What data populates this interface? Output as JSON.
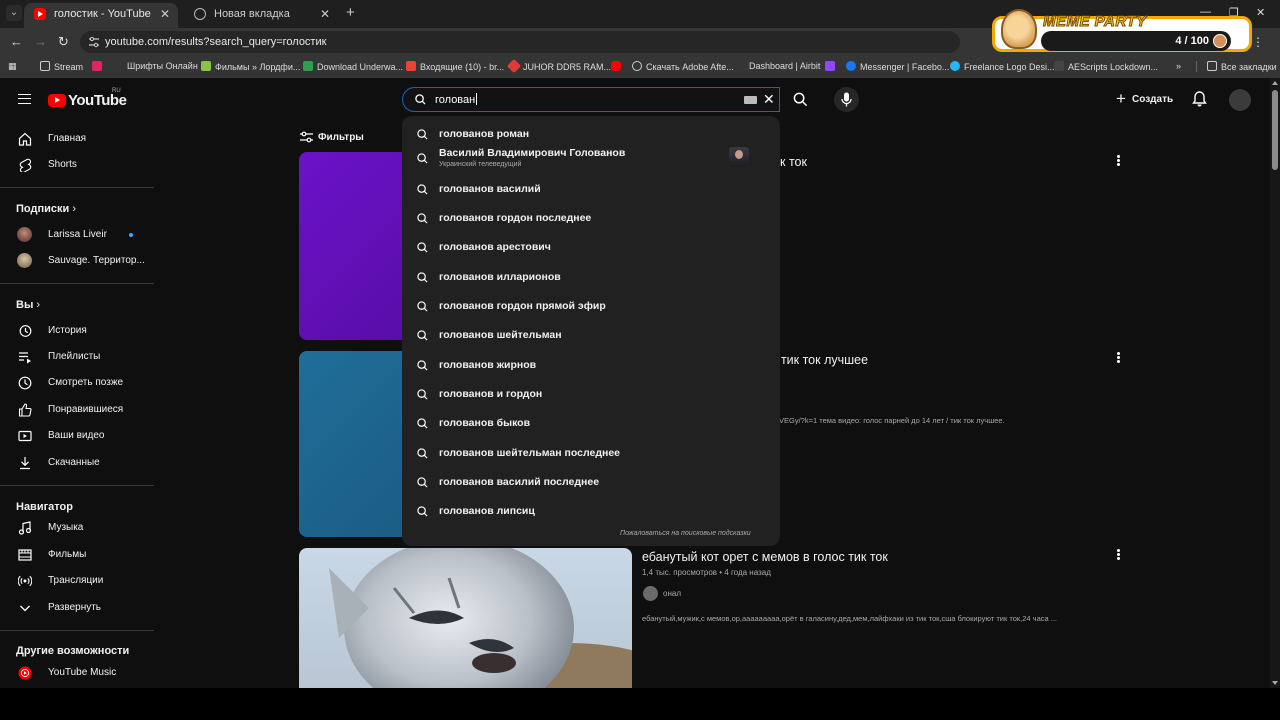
{
  "browser": {
    "tabs": [
      {
        "title": "голостик - YouTube",
        "active": true,
        "icon": "youtube-icon"
      },
      {
        "title": "Новая вкладка",
        "active": false,
        "icon": "globe-icon"
      }
    ],
    "url": "youtube.com/results?search_query=голостик",
    "bookmarks": [
      {
        "label": "Stream",
        "icon": "folder-icon"
      },
      {
        "label": "Шрифты Онлайн",
        "icon": "site-icon"
      },
      {
        "label": "Фильмы » Лордфи...",
        "icon": "site-icon"
      },
      {
        "label": "Download Underwa...",
        "icon": "site-icon"
      },
      {
        "label": "Входящие (10) - br...",
        "icon": "gmail-icon"
      },
      {
        "label": "JUHOR DDR5 RAM...",
        "icon": "site-icon"
      },
      {
        "label": "",
        "icon": "youtube-icon"
      },
      {
        "label": "Скачать Adobe Afte...",
        "icon": "globe-icon"
      },
      {
        "label": "Dashboard | Airbit",
        "icon": "site-icon"
      },
      {
        "label": "",
        "icon": "twitch-icon"
      },
      {
        "label": "Messenger | Facebo...",
        "icon": "facebook-icon"
      },
      {
        "label": "Freelance Logo Desi...",
        "icon": "site-icon"
      },
      {
        "label": "AEScripts Lockdown...",
        "icon": "site-icon"
      }
    ],
    "bookmarks_more": "»",
    "all_bookmarks": "Все закладки"
  },
  "overlay": {
    "brand": "MEME PARTY",
    "score": "4 / 100"
  },
  "youtube": {
    "logo_text": "YouTube",
    "country": "RU",
    "search_value": "голован",
    "create_label": "Создать",
    "filters_label": "Фильтры"
  },
  "sidebar": {
    "main": [
      {
        "label": "Главная",
        "icon": "home-icon"
      },
      {
        "label": "Shorts",
        "icon": "shorts-icon"
      }
    ],
    "subscriptions_title": "Подписки",
    "subscriptions": [
      {
        "label": "Larissa Liveir"
      },
      {
        "label": "Sauvage. Территор..."
      }
    ],
    "you_title": "Вы",
    "you": [
      {
        "label": "История",
        "icon": "history-icon"
      },
      {
        "label": "Плейлисты",
        "icon": "playlist-icon"
      },
      {
        "label": "Смотреть позже",
        "icon": "clock-icon"
      },
      {
        "label": "Понравившиеся",
        "icon": "thumbs-up-icon"
      },
      {
        "label": "Ваши видео",
        "icon": "video-icon"
      },
      {
        "label": "Скачанные",
        "icon": "download-icon"
      }
    ],
    "navigator_title": "Навигатор",
    "navigator": [
      {
        "label": "Музыка",
        "icon": "music-icon"
      },
      {
        "label": "Фильмы",
        "icon": "film-icon"
      },
      {
        "label": "Трансляции",
        "icon": "live-icon"
      },
      {
        "label": "Развернуть",
        "icon": "chevron-down-icon"
      }
    ],
    "more_title": "Другие возможности",
    "more": [
      {
        "label": "YouTube Music",
        "icon": "youtube-music-icon"
      }
    ]
  },
  "results": [
    {
      "title_fragment": "к ток",
      "thumb_color": "#5b0fa8"
    },
    {
      "title_fragment": "/ тик ток лучшее",
      "desc_fragment": "VEGy/?k=1 тема видео: голос парней до 14 лет / тик ток лучшее.",
      "thumb_color": "#1c5f8a"
    },
    {
      "title": "ебанутый кот орет с мемов в голос тик ток",
      "meta": "1,4 тыс. просмотров • 4 года назад",
      "channel": "онал",
      "desc": "ебанутый,мужик,с мемов,ор,ааааааааа,орёт в галасину,дед,мем,лайфхаки из тик ток,сша блокируют тик ток,24 часа ..."
    }
  ],
  "suggestions": [
    {
      "text": "голованов роман"
    },
    {
      "text": "Василий Владимирович Голованов",
      "subtitle": "Украинский телеведущий",
      "thumbnail": true
    },
    {
      "text": "голованов василий"
    },
    {
      "text": "голованов гордон последнее"
    },
    {
      "text": "голованов арестович"
    },
    {
      "text": "голованов илларионов"
    },
    {
      "text": "голованов гордон прямой эфир"
    },
    {
      "text": "голованов шейтельман"
    },
    {
      "text": "голованов жирнов"
    },
    {
      "text": "голованов и гордон"
    },
    {
      "text": "голованов быков"
    },
    {
      "text": "голованов шейтельман последнее"
    },
    {
      "text": "голованов василий последнее"
    },
    {
      "text": "голованов липсиц"
    }
  ],
  "report_suggestions": "Пожаловаться на поисковые подсказки"
}
